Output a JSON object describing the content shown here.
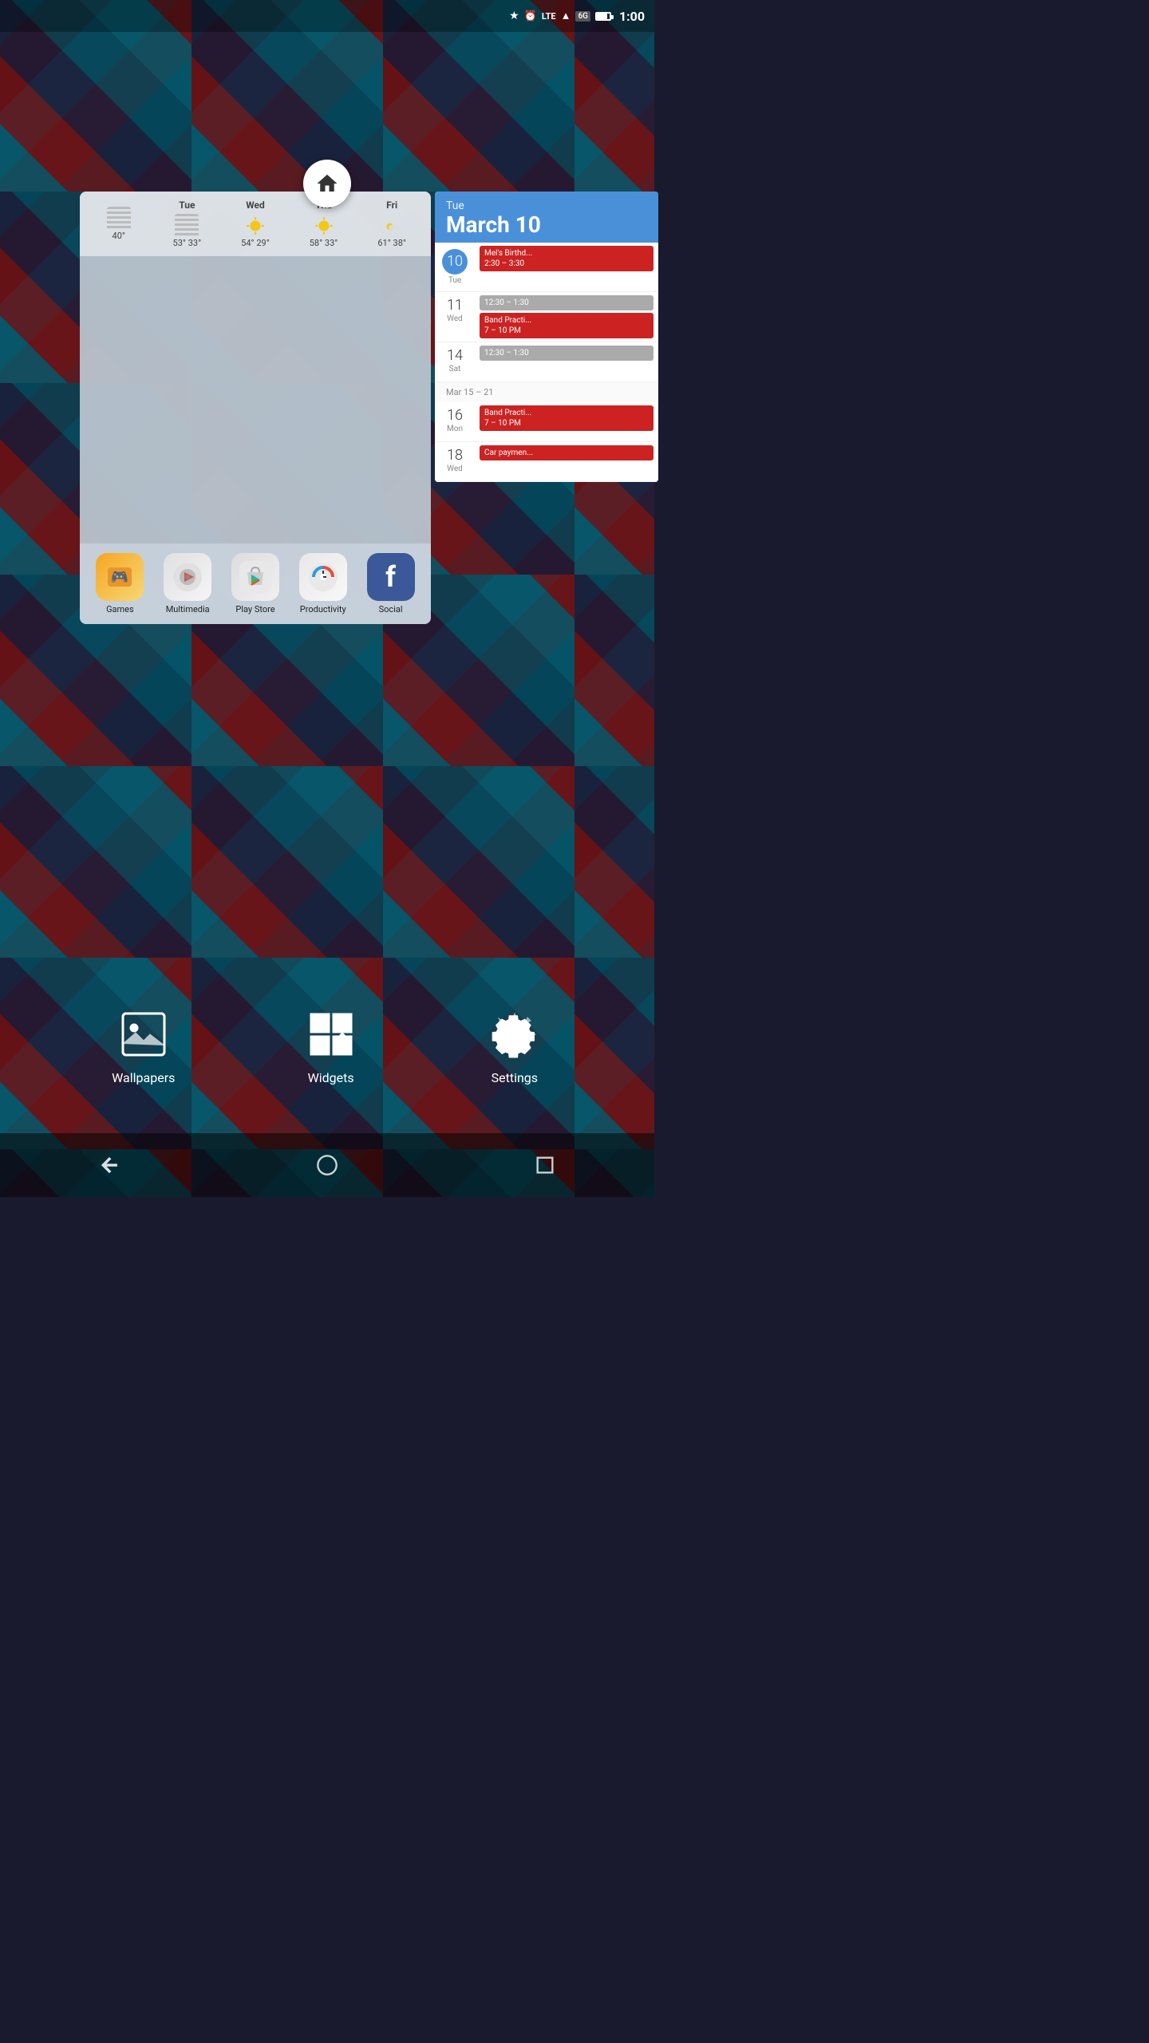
{
  "statusBar": {
    "time": "1:00",
    "batteryPercent": 80
  },
  "weatherWidget": {
    "today": {
      "temp": "40°"
    },
    "days": [
      {
        "name": "Tue",
        "high": "53°",
        "low": "33°",
        "icon": "wavy"
      },
      {
        "name": "Wed",
        "high": "54°",
        "low": "29°",
        "icon": "sunny"
      },
      {
        "name": "Thu",
        "high": "58°",
        "low": "33°",
        "icon": "sunny"
      },
      {
        "name": "Fri",
        "high": "61°",
        "low": "38°",
        "icon": "partlycloudy"
      }
    ]
  },
  "appIcons": [
    {
      "id": "games",
      "label": "Games"
    },
    {
      "id": "multimedia",
      "label": "Multimedia"
    },
    {
      "id": "playstore",
      "label": "Play Store"
    },
    {
      "id": "productivity",
      "label": "Productivity"
    },
    {
      "id": "social",
      "label": "Social"
    }
  ],
  "calendar": {
    "headerDay": "Tue",
    "headerDate": "March 10",
    "entries": [
      {
        "dateNum": "10",
        "weekday": "Tue",
        "isToday": true,
        "events": [
          {
            "title": "Mel's Birthd...",
            "time": "2:30 – 3:30",
            "type": "red"
          }
        ]
      },
      {
        "dateNum": "11",
        "weekday": "Wed",
        "isToday": false,
        "events": [
          {
            "title": "",
            "time": "12:30 – 1:30",
            "type": "gray"
          },
          {
            "title": "Band Practi...",
            "time": "7 – 10 PM",
            "type": "red"
          }
        ]
      },
      {
        "dateNum": "14",
        "weekday": "Sat",
        "isToday": false,
        "events": [
          {
            "title": "",
            "time": "12:30 – 1:30",
            "type": "gray"
          }
        ]
      }
    ],
    "weekLabel": "Mar 15 – 21",
    "laterEntries": [
      {
        "dateNum": "16",
        "weekday": "Mon",
        "isToday": false,
        "events": [
          {
            "title": "Band Practi...",
            "time": "7 – 10 PM",
            "type": "red"
          }
        ]
      },
      {
        "dateNum": "18",
        "weekday": "Wed",
        "isToday": false,
        "events": [
          {
            "title": "Car paymen...",
            "time": "",
            "type": "red"
          }
        ]
      }
    ]
  },
  "bottomOptions": [
    {
      "id": "wallpapers",
      "label": "Wallpapers"
    },
    {
      "id": "widgets",
      "label": "Widgets"
    },
    {
      "id": "settings",
      "label": "Settings"
    }
  ],
  "navBar": {
    "back": "back",
    "home": "home",
    "recents": "recents"
  }
}
